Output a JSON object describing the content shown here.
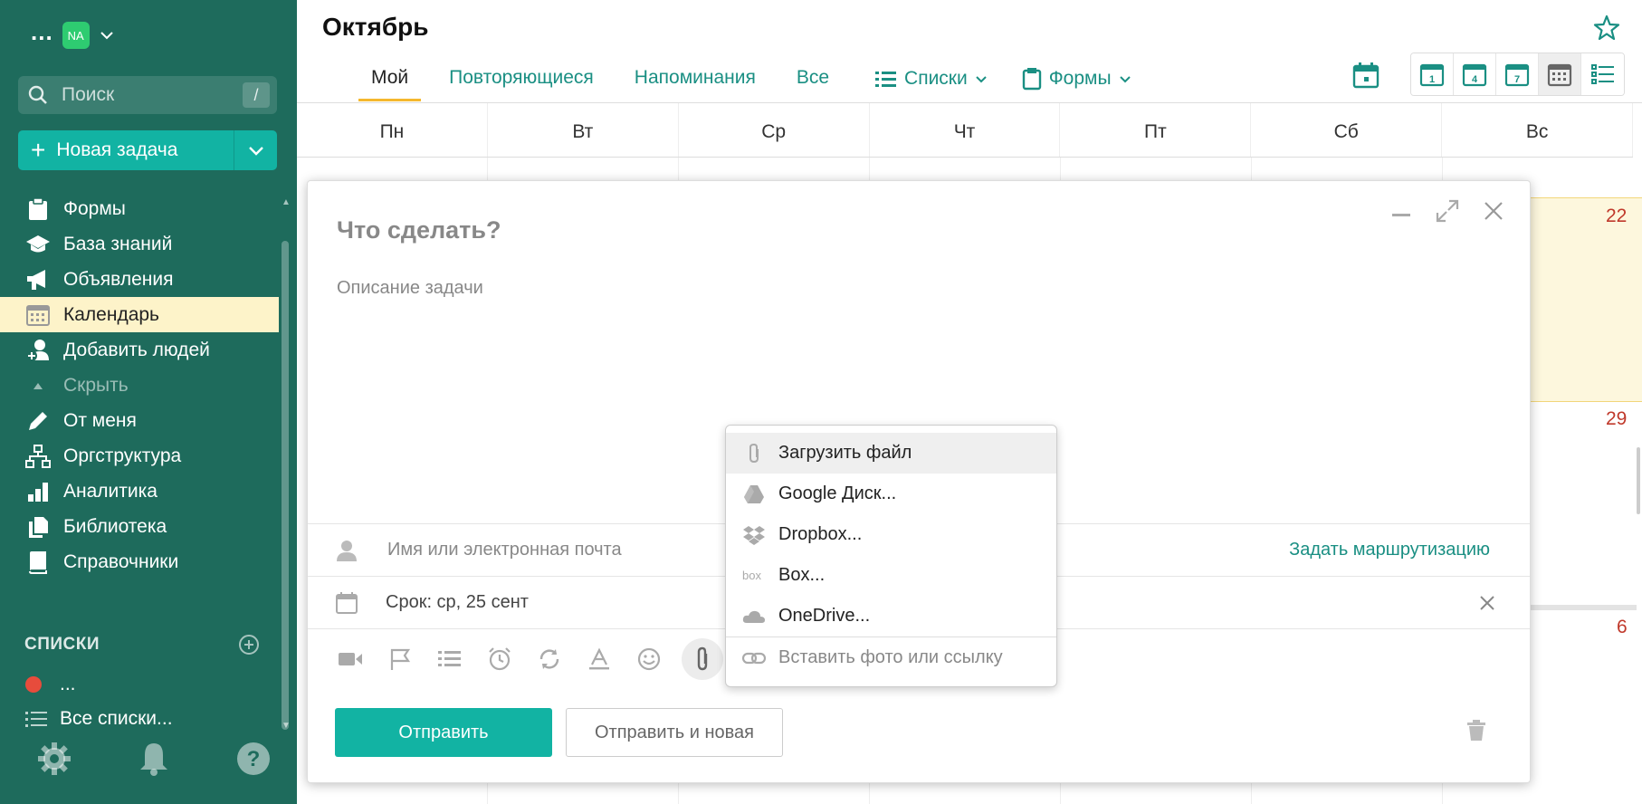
{
  "sidebar": {
    "dots": "...",
    "avatar_initials": "NA",
    "search_placeholder": "Поиск",
    "search_shortcut": "/",
    "new_task_label": "Новая задача",
    "nav": [
      {
        "label": "Формы",
        "icon": "clipboard-icon"
      },
      {
        "label": "База знаний",
        "icon": "graduation-cap-icon"
      },
      {
        "label": "Объявления",
        "icon": "megaphone-icon"
      },
      {
        "label": "Календарь",
        "icon": "calendar-icon",
        "active": true
      },
      {
        "label": "Добавить людей",
        "icon": "add-user-icon"
      },
      {
        "label": "Скрыть",
        "icon": "triangle-up-icon",
        "muted": true
      },
      {
        "label": "От меня",
        "icon": "pencil-icon"
      },
      {
        "label": "Оргструктура",
        "icon": "org-chart-icon"
      },
      {
        "label": "Аналитика",
        "icon": "bar-chart-icon"
      },
      {
        "label": "Библиотека",
        "icon": "files-icon"
      },
      {
        "label": "Справочники",
        "icon": "book-icon"
      }
    ],
    "lists_header": "СПИСКИ",
    "lists": [
      {
        "label": "...",
        "color": "#e74c3c"
      },
      {
        "label": "Все списки..."
      }
    ]
  },
  "header": {
    "title": "Октябрь",
    "tabs": [
      {
        "label": "Мой",
        "active": true
      },
      {
        "label": "Повторяющиеся"
      },
      {
        "label": "Напоминания"
      },
      {
        "label": "Все"
      }
    ],
    "lists_dropdown": "Списки",
    "forms_dropdown": "Формы",
    "view_buttons": [
      "1",
      "4",
      "7",
      "month",
      "list"
    ]
  },
  "calendar": {
    "days": [
      "Пн",
      "Вт",
      "Ср",
      "Чт",
      "Пт",
      "Сб",
      "Вс"
    ],
    "visible_dates": [
      "22",
      "29",
      "6"
    ]
  },
  "task_form": {
    "title_placeholder": "Что сделать?",
    "description_placeholder": "Описание задачи",
    "assignee_placeholder": "Имя или электронная почта",
    "routing_link": "Задать маршрутизацию",
    "deadline_value": "Срок: ср, 25 сент",
    "send_button": "Отправить",
    "send_new_button": "Отправить и новая"
  },
  "attach_menu": {
    "items": [
      {
        "label": "Загрузить файл",
        "icon": "paperclip-icon"
      },
      {
        "label": "Google Диск...",
        "icon": "google-drive-icon"
      },
      {
        "label": "Dropbox...",
        "icon": "dropbox-icon"
      },
      {
        "label": "Box...",
        "icon": "box-icon"
      },
      {
        "label": "OneDrive...",
        "icon": "onedrive-icon"
      }
    ],
    "insert_link": "Вставить фото или ссылку"
  },
  "colors": {
    "sidebar_bg": "#1e6b5c",
    "accent": "#12b3a3",
    "link": "#1a8f83",
    "active_tab_underline": "#f5b82e",
    "weekend_date": "#c0392b"
  }
}
